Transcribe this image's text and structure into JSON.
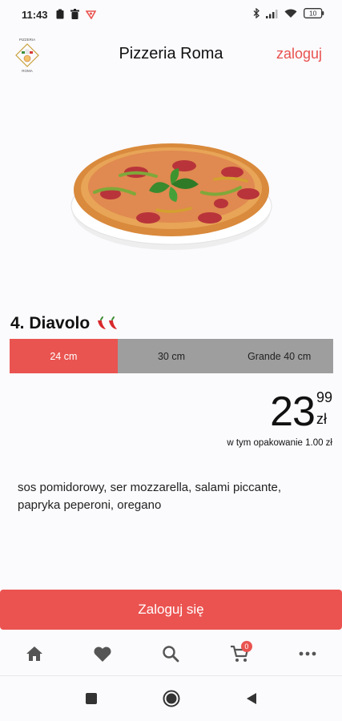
{
  "status_bar": {
    "time": "11:43",
    "left_icons": [
      "clipboard-icon",
      "trash-icon",
      "app-notification-icon"
    ],
    "right_icons": [
      "bluetooth-icon",
      "signal-icon",
      "wifi-icon",
      "battery-icon"
    ],
    "battery_level": "10"
  },
  "header": {
    "title": "Pizzeria Roma",
    "login_link": "zaloguj",
    "logo_text_top": "PIZZERIA",
    "logo_text_bottom": "ROMA"
  },
  "product": {
    "name": "4. Diavolo",
    "spicy_icon": "chili-pepper-icon",
    "sizes": [
      "24 cm",
      "30 cm",
      "Grande 40 cm"
    ],
    "selected_size": "24 cm",
    "price_integer": "23",
    "price_decimal": "99",
    "currency": "zł",
    "packaging_note": "w tym opakowanie 1.00 zł",
    "description": "sos pomidorowy, ser mozzarella, salami piccante, papryka peperoni, oregano"
  },
  "cta": {
    "label": "Zaloguj się"
  },
  "bottom_nav": {
    "items": [
      "home-icon",
      "heart-icon",
      "search-icon",
      "cart-icon",
      "more-icon"
    ],
    "cart_count": "0"
  },
  "system_nav": [
    "recents-icon",
    "home-circle-icon",
    "back-icon"
  ],
  "colors": {
    "accent": "#e95450",
    "inactive_tab": "#9e9e9e",
    "background": "#fbfafd"
  }
}
